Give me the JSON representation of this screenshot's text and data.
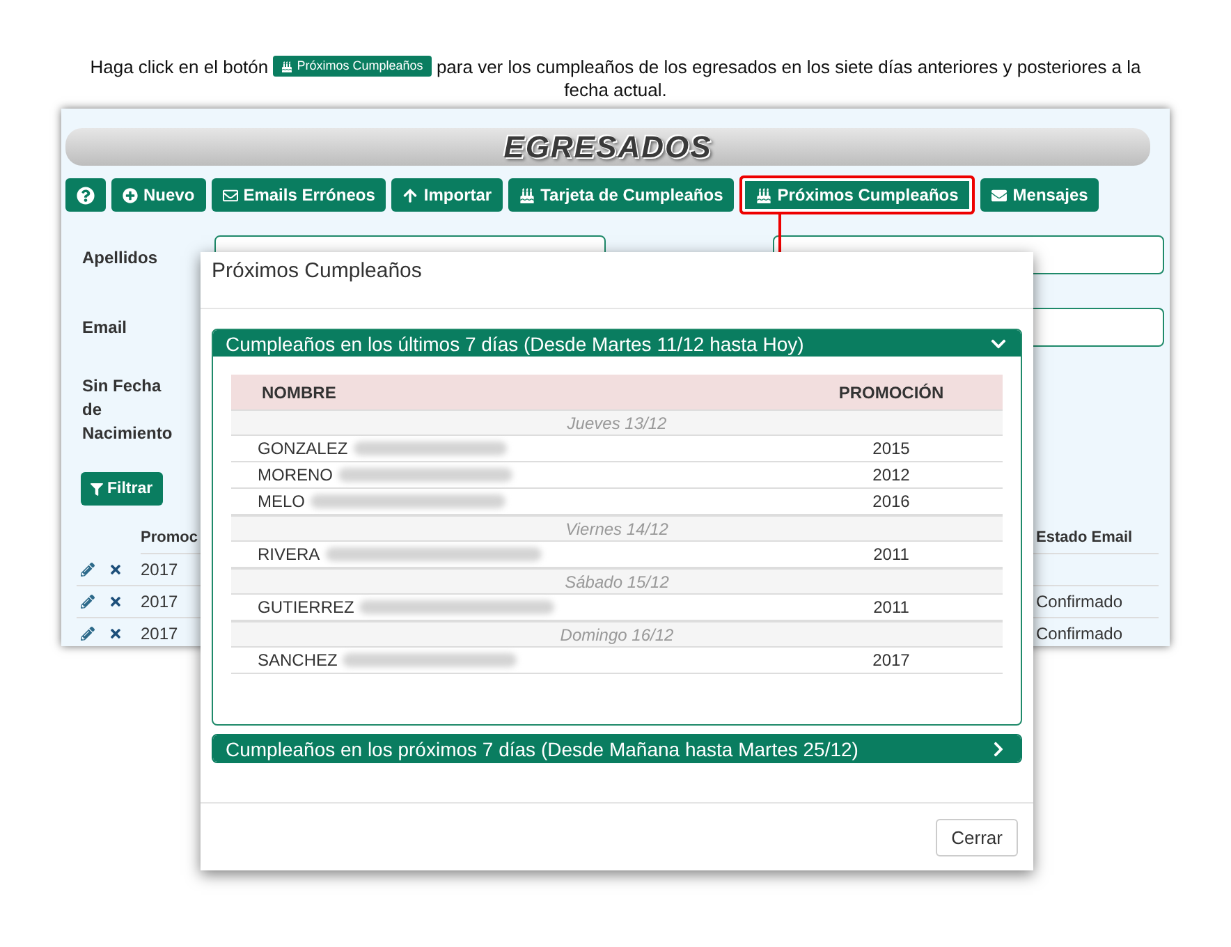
{
  "instruction": {
    "before": "Haga click en el botón",
    "button": "Próximos Cumpleaños",
    "after": "para ver los cumpleaños de los egresados en los siete días anteriores y posteriores a la fecha actual."
  },
  "app": {
    "title": "EGRESADOS",
    "toolbar": [
      {
        "kind": "help",
        "highlighted": false
      },
      {
        "kind": "add",
        "label": "Nuevo",
        "highlighted": false
      },
      {
        "kind": "mail",
        "label": "Emails Erróneos",
        "highlighted": false
      },
      {
        "kind": "upload",
        "label": "Importar",
        "highlighted": false
      },
      {
        "kind": "cake",
        "label": "Tarjeta de Cumpleaños",
        "highlighted": false
      },
      {
        "kind": "cake",
        "label": "Próximos Cumpleaños",
        "highlighted": true
      },
      {
        "kind": "message",
        "label": "Mensajes",
        "highlighted": false
      }
    ],
    "filters": {
      "left_labels": [
        "Apellidos",
        "Email",
        "Sin Fecha de Nacimiento"
      ],
      "button": "Filtrar"
    },
    "table": {
      "columns": [
        "Promoc",
        "Estado Email"
      ],
      "rows": [
        {
          "promocion": "2017"
        },
        {
          "promocion": "2017",
          "estado_email": "Confirmado"
        },
        {
          "promocion": "2017",
          "estado_email": "Confirmado"
        }
      ]
    }
  },
  "modal": {
    "title": "Próximos Cumpleaños",
    "panels": [
      {
        "title": "Cumpleaños en los últimos 7 días (Desde Martes 11/12 hasta Hoy)",
        "expanded": true,
        "columns": [
          "NOMBRE",
          "PROMOCIÓN"
        ],
        "days": [
          {
            "date": "Jueves 13/12",
            "people": [
              {
                "surname": "GONZALEZ",
                "blurred": true,
                "promocion": "2015"
              },
              {
                "surname": "MORENO",
                "blurred": true,
                "promocion": "2012"
              },
              {
                "surname": "MELO",
                "blurred": true,
                "promocion": "2016"
              }
            ]
          },
          {
            "date": "Viernes 14/12",
            "people": [
              {
                "surname": "RIVERA",
                "blurred": true,
                "promocion": "2011"
              }
            ]
          },
          {
            "date": "Sábado 15/12",
            "people": [
              {
                "surname": "GUTIERREZ",
                "blurred": true,
                "promocion": "2011"
              }
            ]
          },
          {
            "date": "Domingo 16/12",
            "people": [
              {
                "surname": "SANCHEZ",
                "blurred": true,
                "promocion": "2017"
              }
            ]
          }
        ]
      },
      {
        "title": "Cumpleaños en los próximos 7 días (Desde Mañana hasta Martes 25/12)",
        "expanded": false
      }
    ],
    "close": "Cerrar"
  }
}
